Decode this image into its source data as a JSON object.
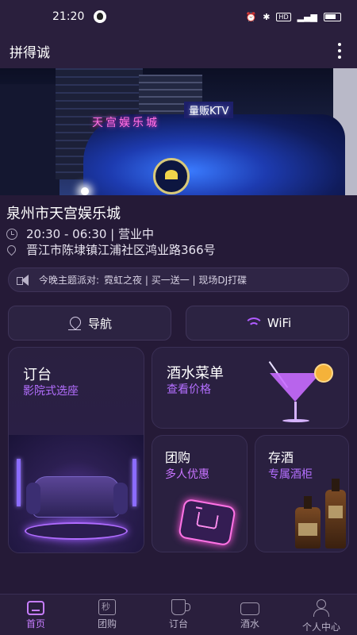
{
  "status_bar": {
    "time": "21:20",
    "right_indicators": "HD  46"
  },
  "app_bar": {
    "title": "拼得诚"
  },
  "banner": {
    "sign_cn": "天宫娱乐城",
    "sign_ktv": "量贩KTV"
  },
  "venue": {
    "name": "泉州市天宫娱乐城",
    "hours": "20:30 - 06:30 | 营业中",
    "address": "晋江市陈埭镇江浦社区鸿业路366号"
  },
  "notice": {
    "label": "今晚主题派对:",
    "text": "霓虹之夜 | 买一送一 | 现场DJ打碟"
  },
  "buttons": {
    "navigate": "导航",
    "wifi": "WiFi"
  },
  "cards": {
    "booking": {
      "title": "订台",
      "subtitle": "影院式选座"
    },
    "drinks": {
      "title": "酒水菜单",
      "subtitle": "查看价格"
    },
    "group": {
      "title": "团购",
      "subtitle": "多人优惠"
    },
    "storage": {
      "title": "存酒",
      "subtitle": "专属酒柜"
    }
  },
  "tabbar": {
    "items": [
      {
        "label": "首页",
        "icon": "home-icon",
        "active": true
      },
      {
        "label": "团购",
        "icon": "deal-icon",
        "active": false
      },
      {
        "label": "订台",
        "icon": "cup-icon",
        "active": false
      },
      {
        "label": "酒水",
        "icon": "sofa-icon",
        "active": false
      },
      {
        "label": "个人中心",
        "icon": "user-icon",
        "active": false
      }
    ]
  },
  "colors": {
    "accent": "#c77dff",
    "background": "#251a37",
    "card": "#2a2040"
  }
}
